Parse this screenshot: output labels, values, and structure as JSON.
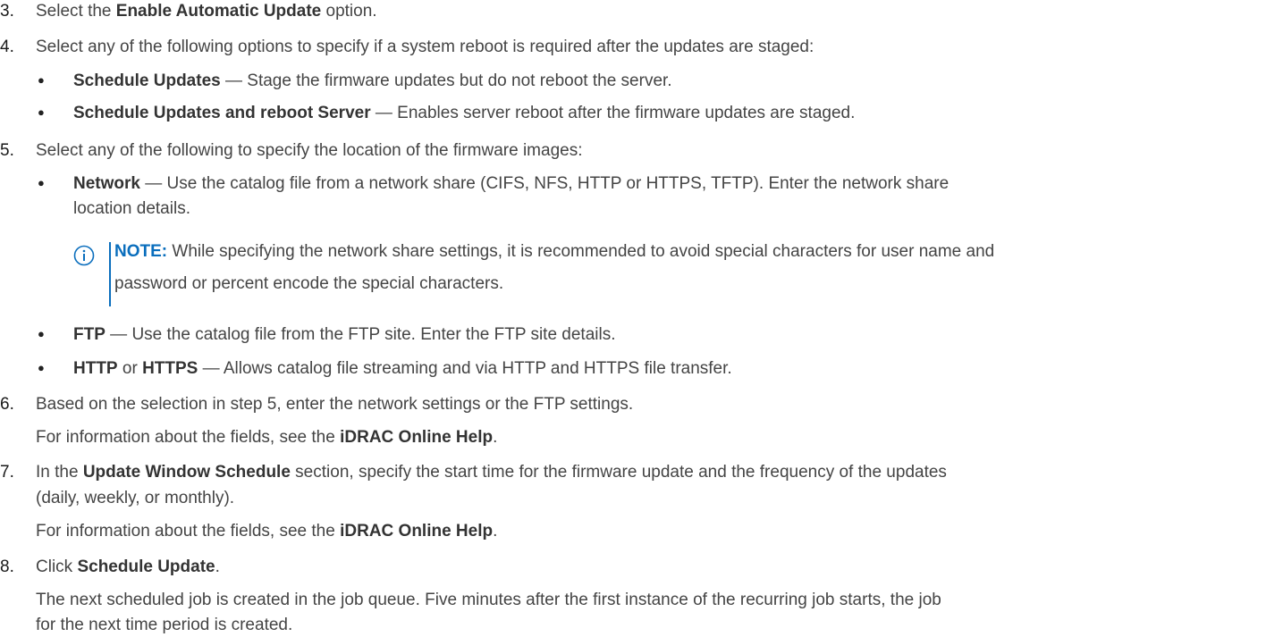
{
  "steps": [
    {
      "num": "3.",
      "pre": "Select the ",
      "bold": "Enable Automatic Update",
      "post": " option."
    },
    {
      "num": "4.",
      "text": "Select any of the following options to specify if a system reboot is required after the updates are staged:"
    },
    {
      "num": "5.",
      "text": "Select any of the following to specify the location of the firmware images:"
    },
    {
      "num": "6.",
      "text": "Based on the selection in step 5, enter the network settings or the FTP settings."
    },
    {
      "num": "7.",
      "pre": "In the ",
      "bold": "Update Window Schedule",
      "post": " section, specify the start time for the firmware update and the frequency of the updates",
      "cont": "(daily, weekly, or monthly)."
    },
    {
      "num": "8.",
      "pre": "Click ",
      "bold": "Schedule Update",
      "post": "."
    }
  ],
  "step4_bullets": [
    {
      "bold": "Schedule Updates",
      "text": " — Stage the firmware updates but do not reboot the server."
    },
    {
      "bold": "Schedule Updates and reboot Server",
      "text": " — Enables server reboot after the firmware updates are staged."
    }
  ],
  "step5_bullets": [
    {
      "bold": "Network",
      "text": " — Use the catalog file from a network share (CIFS, NFS, HTTP or HTTPS, TFTP). Enter the network share",
      "cont": "location details."
    },
    {
      "bold": "FTP",
      "text": " — Use the catalog file from the FTP site. Enter the FTP site details."
    },
    {
      "bold": "HTTP",
      "mid": " or ",
      "bold2": "HTTPS",
      "text": " — Allows catalog file streaming and via HTTP and HTTPS file transfer."
    }
  ],
  "note": {
    "label": "NOTE:",
    "line1": " While specifying the network share settings, it is recommended to avoid special characters for user name and",
    "line2": "password or percent encode the special characters."
  },
  "help_ref": {
    "pre": "For information about the fields, see the ",
    "bold": "iDRAC Online Help",
    "post": "."
  },
  "step8_result": {
    "line1": "The next scheduled job is created in the job queue. Five minutes after the first instance of the recurring job starts, the job",
    "line2": "for the next time period is created."
  },
  "colors": {
    "accent": "#0a6ebd",
    "text": "#444444"
  }
}
